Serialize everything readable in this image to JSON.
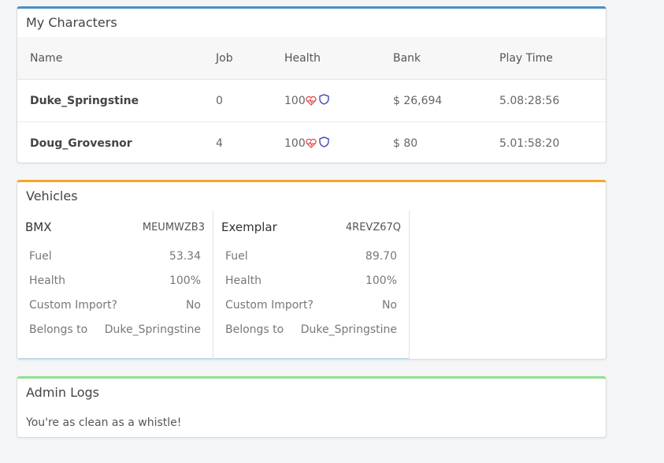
{
  "characters": {
    "title": "My Characters",
    "columns": [
      "Name",
      "Job",
      "Health",
      "Bank",
      "Play Time"
    ],
    "rows": [
      {
        "name": "Duke_Springstine",
        "job": "0",
        "health": "100",
        "bank": "$ 26,694",
        "play_time": "5.08:28:56"
      },
      {
        "name": "Doug_Grovesnor",
        "job": "4",
        "health": "100",
        "bank": "$ 80",
        "play_time": "5.01:58:20"
      }
    ]
  },
  "vehicles": {
    "title": "Vehicles",
    "items": [
      {
        "model": "BMX",
        "plate": "MEUMWZB3",
        "fuel_label": "Fuel",
        "fuel": "53.34",
        "health_label": "Health",
        "health": "100%",
        "custom_label": "Custom Import?",
        "custom": "No",
        "owner_label": "Belongs to",
        "owner": "Duke_Springstine"
      },
      {
        "model": "Exemplar",
        "plate": "4REVZ67Q",
        "fuel_label": "Fuel",
        "fuel": "89.70",
        "health_label": "Health",
        "health": "100%",
        "custom_label": "Custom Import?",
        "custom": "No",
        "owner_label": "Belongs to",
        "owner": "Duke_Springstine"
      }
    ]
  },
  "admin_logs": {
    "title": "Admin Logs",
    "message": "You're as clean as a whistle!"
  },
  "colors": {
    "characters_accent": "#4a8ec2",
    "vehicles_accent": "#f4a62a",
    "logs_accent": "#90e090",
    "heart": "#e04040",
    "shield": "#3a3aa8"
  },
  "icons": {
    "health": "heartbeat-icon",
    "armor": "shield-icon"
  }
}
